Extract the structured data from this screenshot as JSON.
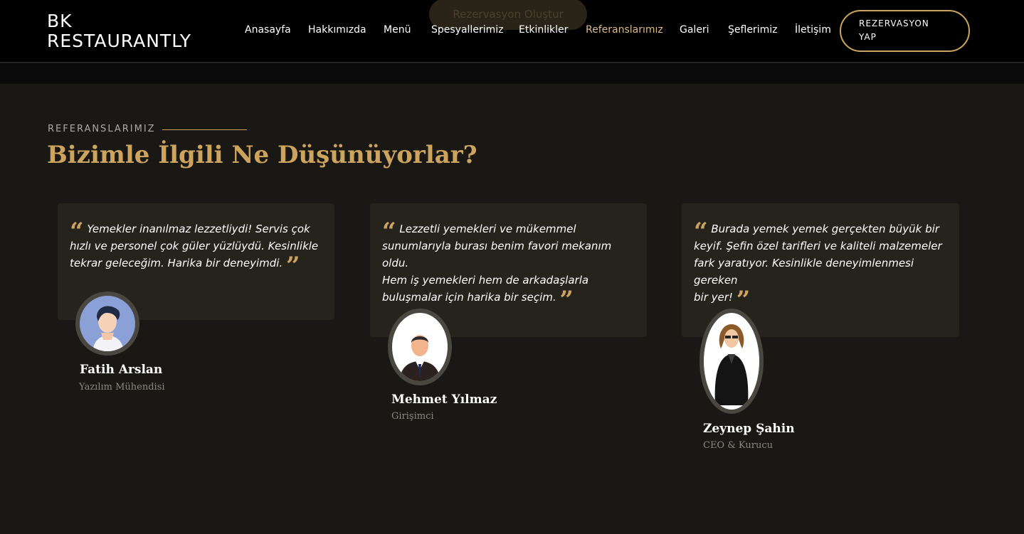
{
  "header": {
    "logo_line1": "BK",
    "logo_line2": "RESTAURANTLY",
    "ghost_button": "Rezervasyon Oluştur",
    "nav": [
      {
        "label": "Anasayfa"
      },
      {
        "label": "Hakkımızda"
      },
      {
        "label": "Menü"
      },
      {
        "label": "Spesyallerimiz"
      },
      {
        "label": "Etkinlikler"
      },
      {
        "label": "Referanslarımız"
      },
      {
        "label": "Galeri"
      },
      {
        "label": "Şeflerimiz"
      },
      {
        "label": "İletişim"
      }
    ],
    "active_nav": "Referanslarımız",
    "cta_line1": "REZERVASYON",
    "cta_line2": "YAP"
  },
  "section": {
    "eyebrow": "REFERANSLARIMIZ",
    "title": "Bizimle İlgili Ne Düşünüyorlar?"
  },
  "testimonials": [
    {
      "quote_lines": [
        "Yemekler inanılmaz lezzetliydi! Servis çok",
        "hızlı ve personel çok güler yüzlüydü. Kesinlikle",
        "tekrar geleceğim. Harika bir deneyimdi."
      ],
      "name": "Fatih Arslan",
      "role": "Yazılım Mühendisi",
      "avatar_icon": "man-illustration-icon"
    },
    {
      "quote_lines": [
        "Lezzetli yemekleri ve mükemmel",
        "sunumlarıyla burası benim favori mekanım oldu.",
        "Hem iş yemekleri hem de arkadaşlarla",
        "buluşmalar için harika bir seçim."
      ],
      "name": "Mehmet Yılmaz",
      "role": "Girişimci",
      "avatar_icon": "businessman-icon"
    },
    {
      "quote_lines": [
        "Burada yemek yemek gerçekten büyük bir",
        "keyif. Şefin özel tarifleri ve kaliteli malzemeler",
        "fark yaratıyor. Kesinlikle deneyimlenmesi gereken",
        "bir yer!"
      ],
      "name": "Zeynep Şahin",
      "role": "CEO & Kurucu",
      "avatar_icon": "businesswoman-icon"
    }
  ],
  "colors": {
    "accent": "#cda45e",
    "background": "#1a1814",
    "card": "#26231d",
    "header": "#000000"
  }
}
